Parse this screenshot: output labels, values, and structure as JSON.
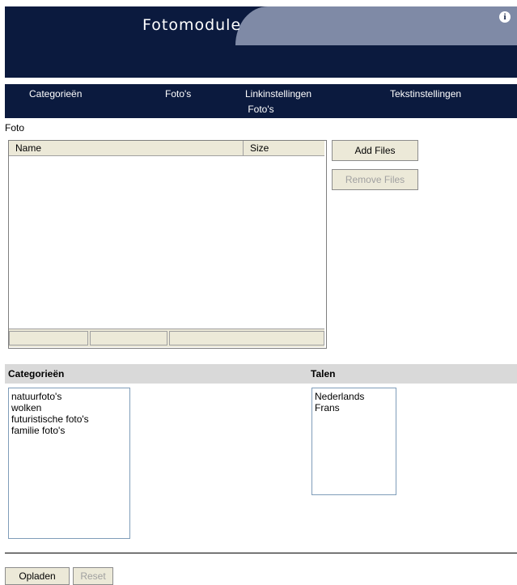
{
  "header": {
    "title": "Fotomodule",
    "info_icon": "info-icon"
  },
  "nav": {
    "items": [
      "Categorieën",
      "Foto's",
      "Linkinstellingen",
      "Tekstinstellingen"
    ],
    "sub": "Foto's"
  },
  "section_label": "Foto",
  "filelist": {
    "col_name": "Name",
    "col_size": "Size"
  },
  "buttons": {
    "add_files": "Add Files",
    "remove_files": "Remove Files",
    "upload": "Opladen",
    "reset": "Reset"
  },
  "categories": {
    "label": "Categorieën",
    "items": [
      "natuurfoto's",
      "wolken",
      "futuristische foto's",
      "familie foto's"
    ]
  },
  "languages": {
    "label": "Talen",
    "items": [
      "Nederlands",
      "Frans"
    ]
  }
}
